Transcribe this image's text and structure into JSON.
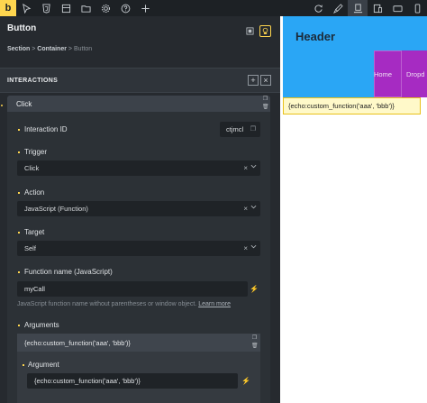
{
  "toolbar": {
    "logo": "b",
    "left_icons": [
      "cursor-icon",
      "html-icon",
      "layers-icon",
      "folder-icon",
      "gear-icon",
      "help-icon",
      "plus-icon"
    ],
    "right_icons": [
      "refresh-icon",
      "brush-icon",
      "desktop-icon",
      "tablet-icon",
      "laptop-icon",
      "mobile-icon"
    ]
  },
  "panel": {
    "title": "Button",
    "breadcrumb": {
      "a": "Section",
      "sep": " > ",
      "b": "Container",
      "c": "Button"
    },
    "section_label": "INTERACTIONS"
  },
  "interaction": {
    "header": "Click",
    "id_label": "Interaction ID",
    "id_value": "ctjmcl",
    "trigger_label": "Trigger",
    "trigger_value": "Click",
    "action_label": "Action",
    "action_value": "JavaScript (Function)",
    "target_label": "Target",
    "target_value": "Self",
    "fn_label": "Function name (JavaScript)",
    "fn_value": "myCall",
    "fn_help": "JavaScript function name without parentheses or window object.",
    "fn_help_link": "Learn more",
    "args_label": "Arguments",
    "arg_header": "{echo:custom_function('aaa', 'bbb')}",
    "arg_label": "Argument",
    "arg_value": "{echo:custom_function('aaa', 'bbb')}"
  },
  "canvas": {
    "header_text": "Header",
    "nav": [
      "Home",
      "Dropd"
    ],
    "echo_text": "{echo:custom_function('aaa', 'bbb')}"
  },
  "colors": {
    "accent": "#ffd64f",
    "header_bg": "#2aa6f5",
    "nav_bg": "#a62bc2",
    "echo_bg": "#fff9c9"
  }
}
